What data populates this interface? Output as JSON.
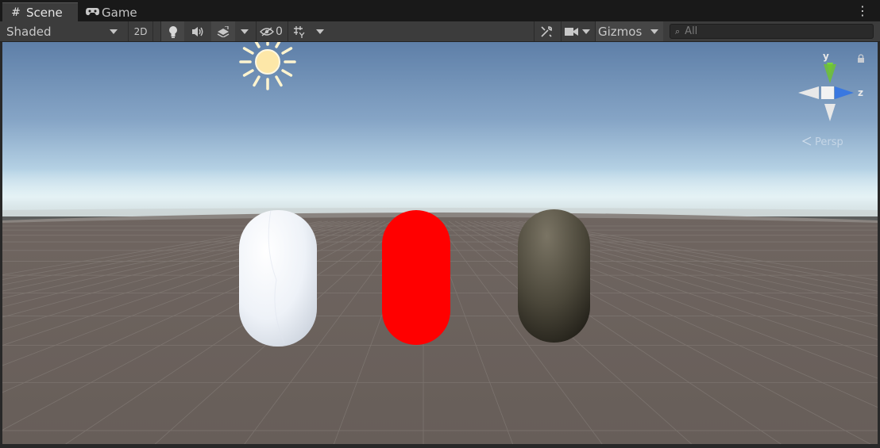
{
  "tabs": [
    {
      "label": "Scene",
      "icon": "grid-hash-icon",
      "active": true
    },
    {
      "label": "Game",
      "icon": "gamepad-icon",
      "active": false
    }
  ],
  "toolbar": {
    "shading_mode": "Shaded",
    "toggle_2d_label": "2D",
    "hidden_count": "0",
    "gizmos_label": "Gizmos",
    "search_placeholder": "All"
  },
  "gizmo": {
    "y_label": "y",
    "z_label": "z",
    "projection_label": "Persp"
  },
  "scene": {
    "capsule_colors": [
      "#f0f2f6",
      "#ff0000",
      "#5a5548"
    ]
  },
  "colors": {
    "sky_top": "#5e7fa8",
    "horizon": "#dfeef2",
    "ground": "#6b625d",
    "axis_y": "#7ad63a",
    "axis_z": "#3a78e0"
  }
}
